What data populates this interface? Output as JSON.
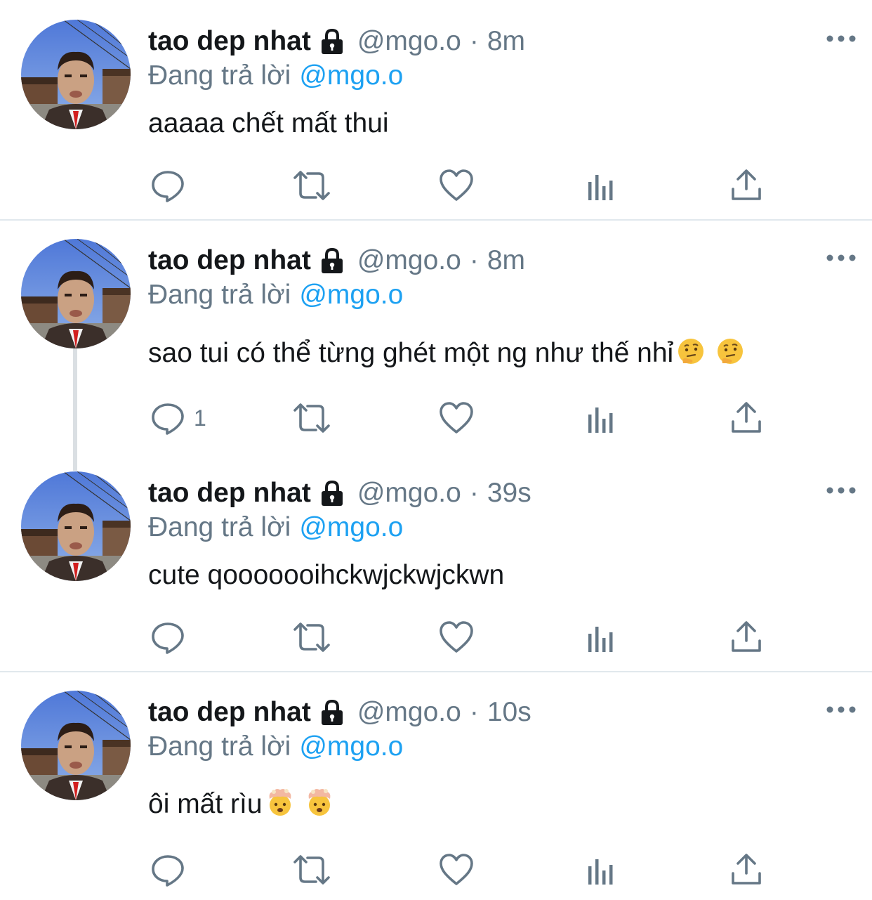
{
  "tweets": [
    {
      "display_name": "tao dep nhat",
      "handle": "@mgo.o",
      "separator": "·",
      "time": "8m",
      "reply_label": "Đang trả lời",
      "reply_to": "@mgo.o",
      "text": "aaaaa chết mất thui",
      "reply_count": ""
    },
    {
      "display_name": "tao dep nhat",
      "handle": "@mgo.o",
      "separator": "·",
      "time": "8m",
      "reply_label": "Đang trả lời",
      "reply_to": "@mgo.o",
      "text": "sao tui có thể từng ghét một ng như thế nhỉ",
      "trailing_emojis": [
        "thinking-face-emoji",
        "thinking-face-emoji"
      ],
      "reply_count": "1"
    },
    {
      "display_name": "tao dep nhat",
      "handle": "@mgo.o",
      "separator": "·",
      "time": "39s",
      "reply_label": "Đang trả lời",
      "reply_to": "@mgo.o",
      "text": "cute qooooooihckwjckwjckwn",
      "reply_count": ""
    },
    {
      "display_name": "tao dep nhat",
      "handle": "@mgo.o",
      "separator": "·",
      "time": "10s",
      "reply_label": "Đang trả lời",
      "reply_to": "@mgo.o",
      "text": "ôi mất rìu",
      "trailing_emojis": [
        "exploding-head-emoji",
        "exploding-head-emoji"
      ],
      "reply_count": ""
    }
  ],
  "icons": {
    "protected": "lock-icon",
    "more": "more-horizontal-icon",
    "reply": "reply-bubble-icon",
    "retweet": "retweet-icon",
    "like": "heart-icon",
    "analytics": "analytics-icon",
    "share": "share-icon"
  },
  "colors": {
    "text": "#14171a",
    "secondary": "#657786",
    "link": "#1da1f2",
    "divider": "#e1e8ed",
    "thread_line": "#dadfe3"
  }
}
